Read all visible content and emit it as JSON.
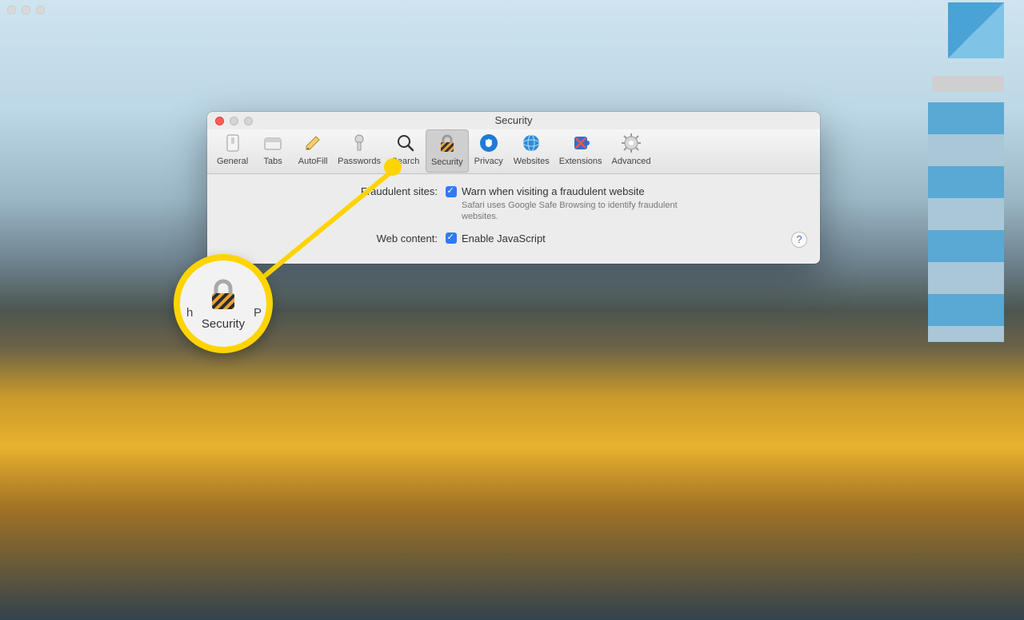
{
  "window": {
    "title": "Security",
    "toolbar": [
      {
        "id": "general",
        "label": "General"
      },
      {
        "id": "tabs",
        "label": "Tabs"
      },
      {
        "id": "autofill",
        "label": "AutoFill"
      },
      {
        "id": "passwords",
        "label": "Passwords"
      },
      {
        "id": "search",
        "label": "Search"
      },
      {
        "id": "security",
        "label": "Security",
        "selected": true
      },
      {
        "id": "privacy",
        "label": "Privacy"
      },
      {
        "id": "websites",
        "label": "Websites"
      },
      {
        "id": "extensions",
        "label": "Extensions"
      },
      {
        "id": "advanced",
        "label": "Advanced"
      }
    ],
    "sections": {
      "fraud": {
        "label": "Fraudulent sites:",
        "checkbox": "Warn when visiting a fraudulent website",
        "checked": true,
        "note": "Safari uses Google Safe Browsing to identify fraudulent websites."
      },
      "web": {
        "label": "Web content:",
        "checkbox": "Enable JavaScript",
        "checked": true
      }
    },
    "help": "?"
  },
  "callout": {
    "label": "Security",
    "left_hint": "h",
    "right_hint": "P"
  }
}
